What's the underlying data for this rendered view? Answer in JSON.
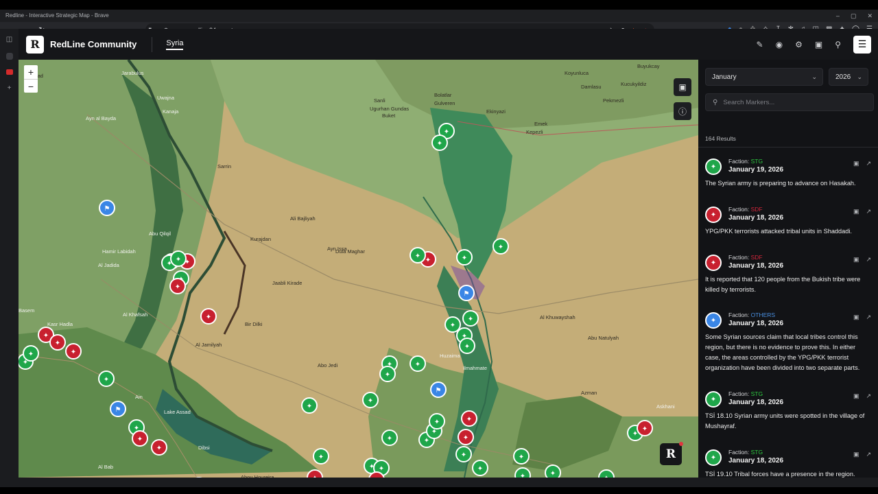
{
  "browser": {
    "window_title": "Redline - Interactive Strategic Map - Brave",
    "url": "map.redline24.com.tr",
    "window_controls": [
      "–",
      "▢",
      "✕"
    ]
  },
  "app": {
    "logo_letter": "R",
    "brand": "RedLine Community",
    "tab": "Syria"
  },
  "filters": {
    "month": "January",
    "year": "2026",
    "search_placeholder": "Search Markers...",
    "results": "164 Results"
  },
  "map": {
    "zoom_in": "+",
    "zoom_out": "−",
    "watermark_letter": "R",
    "labels": [
      {
        "text": "Buyukcay",
        "cls": "dark"
      },
      {
        "text": "Telxatad",
        "cls": "dark"
      },
      {
        "text": "Bolatlar",
        "cls": "dark"
      },
      {
        "text": "Gulveren",
        "cls": "dark"
      },
      {
        "text": "Sanli",
        "cls": "dark"
      },
      {
        "text": "Ugurhan Gundas",
        "cls": "dark"
      },
      {
        "text": "Buket",
        "cls": "dark"
      },
      {
        "text": "Damlasu",
        "cls": "dark"
      },
      {
        "text": "Kucukyildiz",
        "cls": "dark"
      },
      {
        "text": "Pekmezli",
        "cls": "dark"
      },
      {
        "text": "Koyunluca",
        "cls": "dark"
      },
      {
        "text": "Ekinyazi",
        "cls": "dark"
      },
      {
        "text": "Emek",
        "cls": "dark"
      },
      {
        "text": "Kepezli",
        "cls": "dark"
      },
      {
        "text": "Ayn al Bayda",
        "cls": "light"
      },
      {
        "text": "Uwajna",
        "cls": "light"
      },
      {
        "text": "Kanaja",
        "cls": "light"
      },
      {
        "text": "Jarabulus",
        "cls": "light"
      },
      {
        "text": "Sarrin",
        "cls": "dark"
      },
      {
        "text": "Ali Bajliyah",
        "cls": "dark"
      },
      {
        "text": "Kurajdan",
        "cls": "dark"
      },
      {
        "text": "Dula Maghar",
        "cls": "dark"
      },
      {
        "text": "Hamir Labidah",
        "cls": "light"
      },
      {
        "text": "Abu Qilqil",
        "cls": "light"
      },
      {
        "text": "Al Jadida",
        "cls": "light"
      },
      {
        "text": "Ayn Issa",
        "cls": "dark"
      },
      {
        "text": "Jaabli Kirade",
        "cls": "dark"
      },
      {
        "text": "Al Khuwayshah",
        "cls": "dark"
      },
      {
        "text": "Abu Natulyah",
        "cls": "dark"
      },
      {
        "text": "Al Khafsah",
        "cls": "light"
      },
      {
        "text": "Kasr Hadla",
        "cls": "light"
      },
      {
        "text": "Basem",
        "cls": "light"
      },
      {
        "text": "Bir Dilki",
        "cls": "dark"
      },
      {
        "text": "Al Jamilyah",
        "cls": "dark"
      },
      {
        "text": "Abo Jedi",
        "cls": "dark"
      },
      {
        "text": "Huzaima",
        "cls": "light"
      },
      {
        "text": "Ilmahmate",
        "cls": "light"
      },
      {
        "text": "Azman",
        "cls": "dark"
      },
      {
        "text": "Askhani",
        "cls": "light"
      },
      {
        "text": "Lake Assad",
        "cls": "light"
      },
      {
        "text": "Dibsi",
        "cls": "light"
      },
      {
        "text": "Al Bab",
        "cls": "light"
      },
      {
        "text": "Abou Houreira",
        "cls": "dark"
      },
      {
        "text": "Ain",
        "cls": "light"
      }
    ]
  },
  "feed": [
    {
      "faction_label": "Faction:",
      "faction": "STG",
      "faction_color": "#2ecc40",
      "badge_color": "#1fa64a",
      "date": "January 19, 2026",
      "text": "The Syrian army is preparing to advance on Hasakah."
    },
    {
      "faction_label": "Faction:",
      "faction": "SDF",
      "faction_color": "#d6263c",
      "badge_color": "#c8202f",
      "date": "January 18, 2026",
      "text": "YPG/PKK terrorists attacked tribal units in Shaddadi."
    },
    {
      "faction_label": "Faction:",
      "faction": "SDF",
      "faction_color": "#d6263c",
      "badge_color": "#c8202f",
      "date": "January 18, 2026",
      "text": "It is reported that 120 people from the Bukish tribe were killed by terrorists."
    },
    {
      "faction_label": "Faction:",
      "faction": "OTHERS",
      "faction_color": "#4a90e2",
      "badge_color": "#3a86e6",
      "date": "January 18, 2026",
      "text": "Some Syrian sources claim that local tribes control this region, but there is no evidence to prove this. In either case, the areas controlled by the YPG/PKK terrorist organization have been divided into two separate parts."
    },
    {
      "faction_label": "Faction:",
      "faction": "STG",
      "faction_color": "#2ecc40",
      "badge_color": "#1fa64a",
      "date": "January 18, 2026",
      "text": "TSİ 18.10 Syrian army units were spotted in the village of Mushayraf."
    },
    {
      "faction_label": "Faction:",
      "faction": "STG",
      "faction_color": "#2ecc40",
      "badge_color": "#1fa64a",
      "date": "January 18, 2026",
      "text": "TSİ 19.10 Tribal forces have a presence in the region."
    }
  ],
  "colors": {
    "stg": "#1fa64a",
    "sdf": "#c8202f",
    "others": "#3a86e6",
    "regime_navy": "#1f2a6b"
  },
  "icons": {
    "back": "arrow-left-icon",
    "forward": "arrow-right-icon",
    "reload": "reload-icon",
    "bookmark": "bookmark-icon",
    "search": "search-icon",
    "layers": "map-layers-icon",
    "info": "info-icon",
    "camera": "camera-icon",
    "settings": "gear-icon",
    "pin": "pin-icon",
    "draw": "pencil-icon",
    "menu": "menu-icon"
  }
}
